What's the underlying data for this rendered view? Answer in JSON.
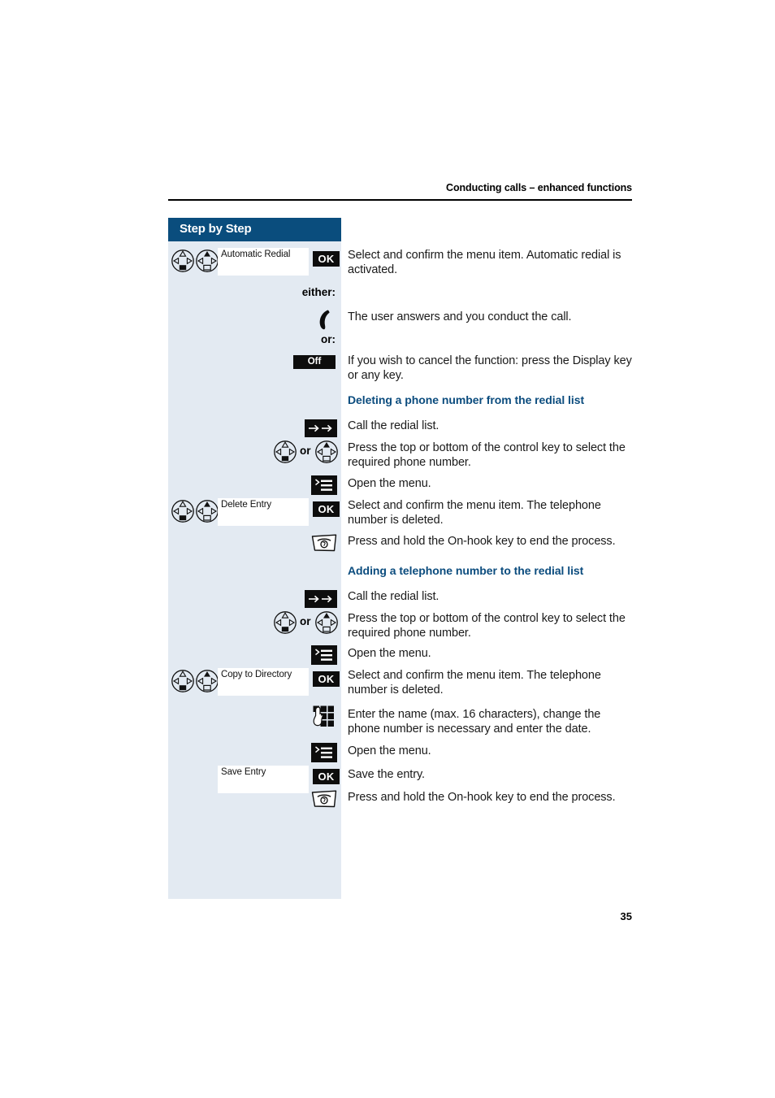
{
  "page": {
    "running_head": "Conducting calls – enhanced functions",
    "page_number": "35",
    "accent_blue": "#0a4d7d",
    "heading_blue": "#0b4c7e",
    "panel_bg": "#e3eaf2"
  },
  "sidebar": {
    "title": "Step by Step"
  },
  "rows": {
    "r1": {
      "menu_item": "Automatic Redial",
      "key_label": "OK",
      "text": "Select and confirm the menu item. Automatic redial is activated."
    },
    "r2": {
      "label": "either:"
    },
    "r3": {
      "text": "The user answers and you conduct the call."
    },
    "r4": {
      "label": "or:"
    },
    "r5": {
      "key_label": "Off",
      "text": "If you wish to cancel the function: press the Display key or any key."
    },
    "r6": {
      "heading": "Deleting a phone number from the redial list"
    },
    "r7": {
      "text": "Call the redial list."
    },
    "r8": {
      "conjunction": "or",
      "text": "Press the top or bottom of the control key to select the required phone number."
    },
    "r9": {
      "text": "Open the menu."
    },
    "r10": {
      "menu_item": "Delete Entry",
      "key_label": "OK",
      "text": "Select and confirm the menu item. The telephone number is deleted."
    },
    "r11": {
      "text": "Press and hold the On-hook key to end the process."
    },
    "r12": {
      "heading": "Adding a telephone number to the redial list"
    },
    "r13": {
      "text": "Call the redial list."
    },
    "r14": {
      "conjunction": "or",
      "text": "Press the top or bottom of the control key to select the required phone number."
    },
    "r15": {
      "text": "Open the menu."
    },
    "r16": {
      "menu_item": "Copy to Directory",
      "key_label": "OK",
      "text": "Select and confirm the menu item. The telephone number is deleted."
    },
    "r17": {
      "text": "Enter the name (max. 16 characters), change the phone number is necessary and enter the date."
    },
    "r18": {
      "text": "Open the menu."
    },
    "r19": {
      "menu_item": "Save Entry",
      "key_label": "OK",
      "text": "Save the entry."
    },
    "r20": {
      "text": "Press and hold the On-hook key to end the process."
    }
  }
}
